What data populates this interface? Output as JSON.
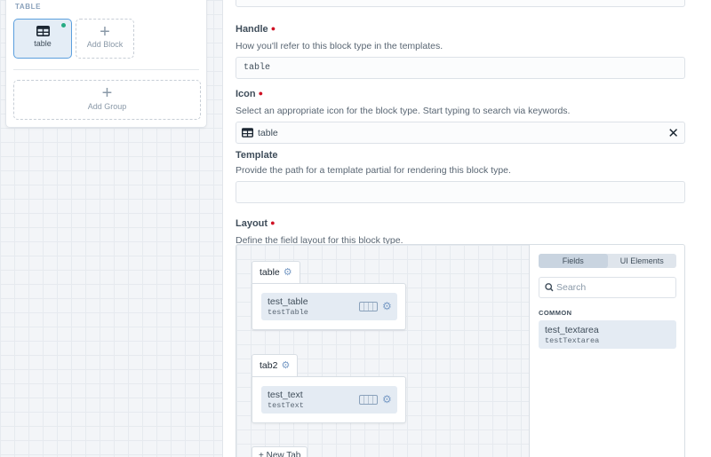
{
  "sidebar": {
    "group_title": "TABLE",
    "blocks": [
      {
        "label": "table",
        "icon": "table-icon",
        "selected": true,
        "status": "enabled"
      }
    ],
    "add_block_label": "Add Block",
    "add_group_label": "Add Group"
  },
  "form": {
    "handle": {
      "label": "Handle",
      "instructions": "How you'll refer to this block type in the templates.",
      "value": "table"
    },
    "icon": {
      "label": "Icon",
      "instructions": "Select an appropriate icon for the block type. Start typing to search via keywords.",
      "value": "table",
      "icon": "table-icon",
      "clear_symbol": "✕"
    },
    "template": {
      "label": "Template",
      "instructions": "Provide the path for a template partial for rendering this block type.",
      "value": ""
    },
    "layout": {
      "label": "Layout",
      "instructions": "Define the field layout for this block type.",
      "tabs": [
        {
          "name": "table",
          "fields": [
            {
              "name": "test_table",
              "handle": "testTable"
            }
          ]
        },
        {
          "name": "tab2",
          "fields": [
            {
              "name": "test_text",
              "handle": "testText"
            }
          ]
        }
      ],
      "new_tab_label": "+ New Tab",
      "library": {
        "segments": [
          "Fields",
          "UI Elements"
        ],
        "active_segment": "Fields",
        "search_placeholder": "Search",
        "group_heading": "COMMON",
        "fields": [
          {
            "name": "test_textarea",
            "handle": "testTextarea"
          }
        ]
      }
    }
  },
  "colors": {
    "accent": "#5b9fde",
    "required": "#cf1124",
    "enabled_dot": "#27ab83",
    "pill": "#e4ebf3"
  }
}
